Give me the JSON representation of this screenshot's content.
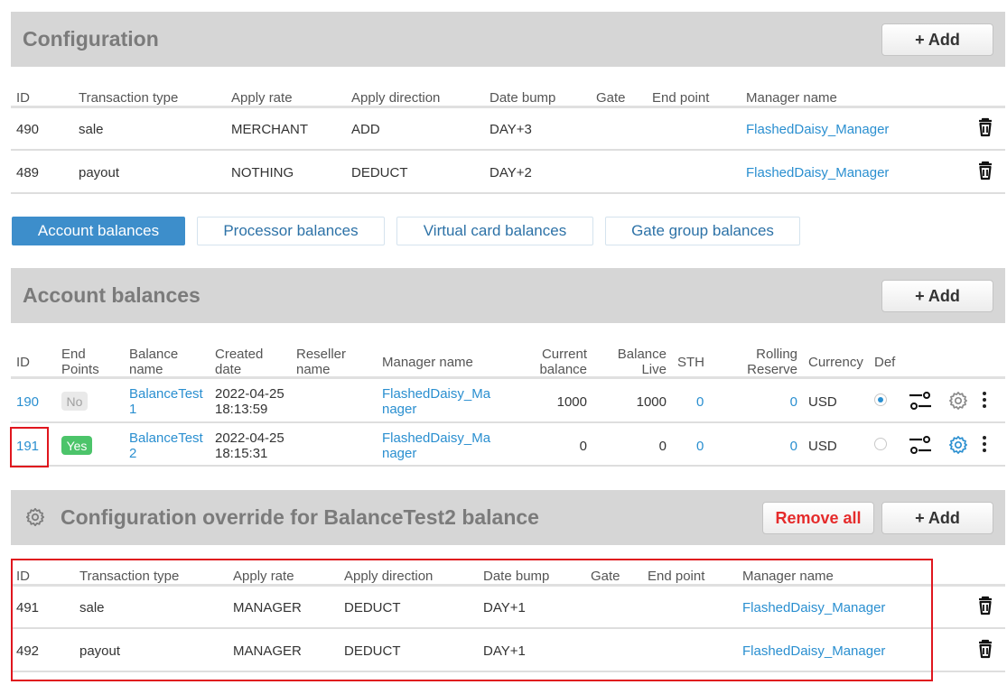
{
  "configuration": {
    "title": "Configuration",
    "add_label": "+ Add",
    "columns": [
      "ID",
      "Transaction type",
      "Apply rate",
      "Apply direction",
      "Date bump",
      "Gate",
      "End point",
      "Manager name"
    ],
    "rows": [
      {
        "id": "490",
        "type": "sale",
        "rate": "MERCHANT",
        "direction": "ADD",
        "bump": "DAY+3",
        "gate": "",
        "endpoint": "",
        "manager": "FlashedDaisy_Manager"
      },
      {
        "id": "489",
        "type": "payout",
        "rate": "NOTHING",
        "direction": "DEDUCT",
        "bump": "DAY+2",
        "gate": "",
        "endpoint": "",
        "manager": "FlashedDaisy_Manager"
      }
    ]
  },
  "tabs": [
    {
      "label": "Account balances",
      "active": true
    },
    {
      "label": "Processor balances",
      "active": false
    },
    {
      "label": "Virtual card balances",
      "active": false
    },
    {
      "label": "Gate group balances",
      "active": false
    }
  ],
  "balances": {
    "title": "Account balances",
    "add_label": "+ Add",
    "columns": {
      "id": "ID",
      "endpoints": [
        "End",
        "Points"
      ],
      "balance_name": [
        "Balance",
        "name"
      ],
      "created": [
        "Created",
        "date"
      ],
      "reseller": [
        "Reseller",
        "name"
      ],
      "manager": "Manager name",
      "current": [
        "Current",
        "balance"
      ],
      "live": [
        "Balance",
        "Live"
      ],
      "sth": "STH",
      "rolling": [
        "Rolling",
        "Reserve"
      ],
      "currency": "Currency",
      "def": "Def"
    },
    "rows": [
      {
        "id": "190",
        "endpoints": "No",
        "name": [
          "BalanceTest",
          "1"
        ],
        "created": [
          "2022-04-25",
          "18:13:59"
        ],
        "reseller": "",
        "manager": [
          "FlashedDaisy_Ma",
          "nager"
        ],
        "current": "1000",
        "live": "1000",
        "sth": "0",
        "rolling": "0",
        "currency": "USD",
        "default": true
      },
      {
        "id": "191",
        "endpoints": "Yes",
        "name": [
          "BalanceTest",
          "2"
        ],
        "created": [
          "2022-04-25",
          "18:15:31"
        ],
        "reseller": "",
        "manager": [
          "FlashedDaisy_Ma",
          "nager"
        ],
        "current": "0",
        "live": "0",
        "sth": "0",
        "rolling": "0",
        "currency": "USD",
        "default": false
      }
    ]
  },
  "override": {
    "title": "Configuration override for BalanceTest2 balance",
    "remove_label": "Remove all",
    "add_label": "+ Add",
    "columns": [
      "ID",
      "Transaction type",
      "Apply rate",
      "Apply direction",
      "Date bump",
      "Gate",
      "End point",
      "Manager name"
    ],
    "rows": [
      {
        "id": "491",
        "type": "sale",
        "rate": "MANAGER",
        "direction": "DEDUCT",
        "bump": "DAY+1",
        "gate": "",
        "endpoint": "",
        "manager": "FlashedDaisy_Manager"
      },
      {
        "id": "492",
        "type": "payout",
        "rate": "MANAGER",
        "direction": "DEDUCT",
        "bump": "DAY+1",
        "gate": "",
        "endpoint": "",
        "manager": "FlashedDaisy_Manager"
      }
    ]
  },
  "colors": {
    "link": "#2a8fd0",
    "tab_active": "#3d8ecb",
    "panel_header": "#d6d6d6",
    "remove": "#e52b2b",
    "badge_yes": "#4cc46a",
    "highlight": "#e0161e"
  }
}
